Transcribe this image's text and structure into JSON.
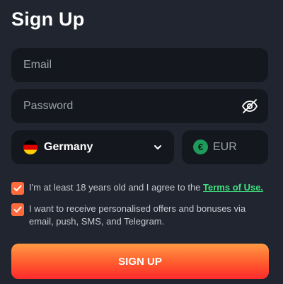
{
  "page": {
    "title": "Sign Up"
  },
  "form": {
    "email_placeholder": "Email",
    "password_placeholder": "Password",
    "country": {
      "selected": "Germany",
      "flag_icon": "flag-germany-icon"
    },
    "currency": {
      "label": "EUR",
      "icon": "euro-icon",
      "symbol": "€"
    }
  },
  "consents": {
    "age": {
      "text": "I'm at least 18 years old and I agree to the",
      "link": "Terms of Use.",
      "checked": true
    },
    "marketing": {
      "text": "I want to receive personalised offers and bonuses via email, push, SMS, and Telegram.",
      "checked": true
    }
  },
  "submit_label": "SIGN UP",
  "colors": {
    "background": "#20252f",
    "field": "#14171e",
    "accent": "#ff6b3d",
    "link": "#3ee07f",
    "euro_badge": "#1e9b5a"
  }
}
